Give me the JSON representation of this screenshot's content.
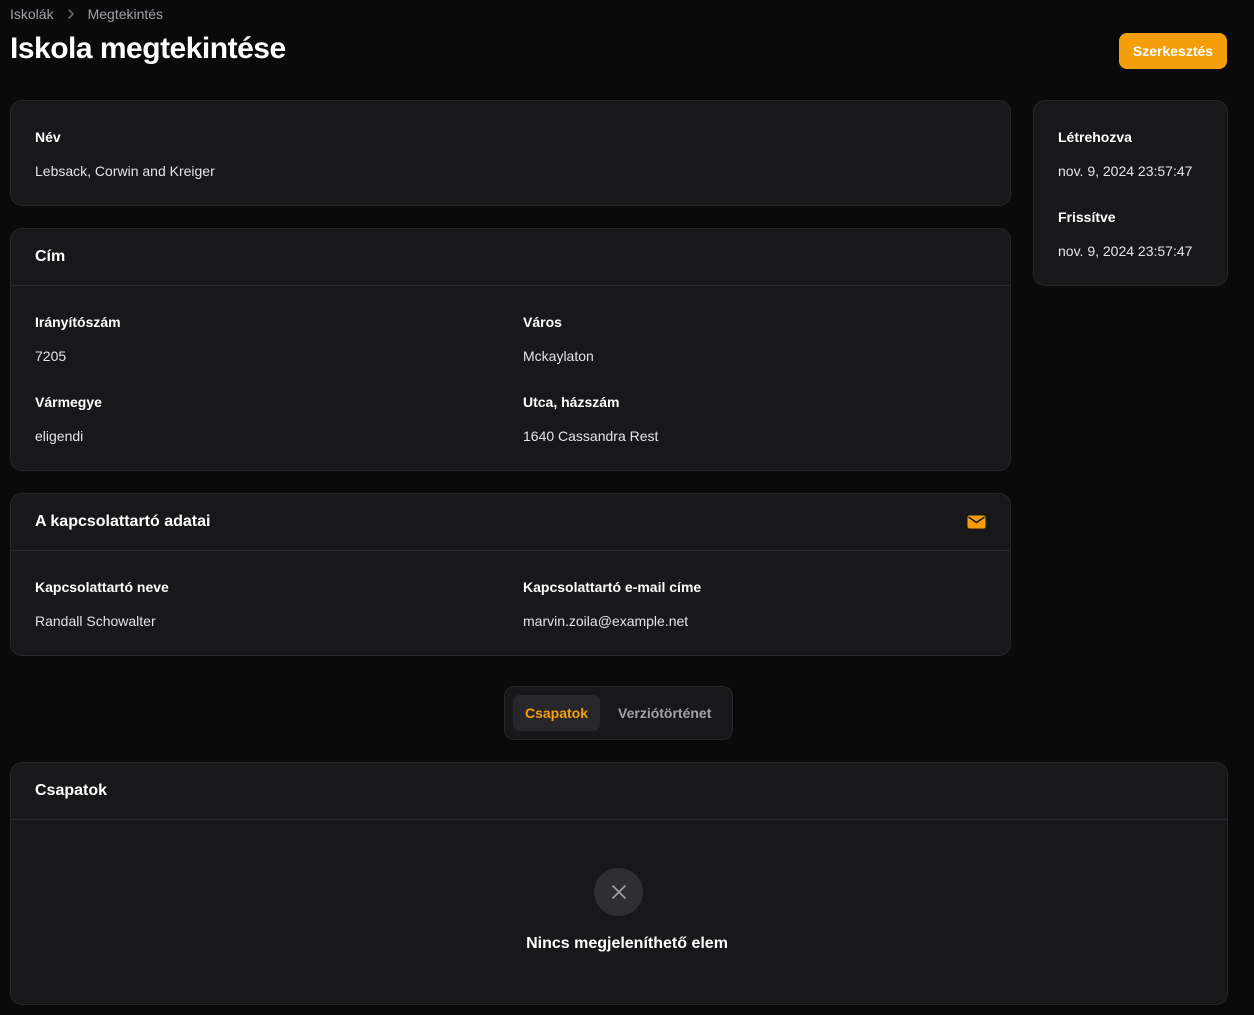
{
  "breadcrumb": {
    "items": [
      "Iskolák",
      "Megtekintés"
    ]
  },
  "header": {
    "title": "Iskola megtekintése",
    "edit_label": "Szerkesztés"
  },
  "name_card": {
    "label": "Név",
    "value": "Lebsack, Corwin and Kreiger"
  },
  "meta_card": {
    "created_label": "Létrehozva",
    "created_value": "nov. 9, 2024 23:57:47",
    "updated_label": "Frissítve",
    "updated_value": "nov. 9, 2024 23:57:47"
  },
  "address_card": {
    "title": "Cím",
    "zip_label": "Irányítószám",
    "zip_value": "7205",
    "city_label": "Város",
    "city_value": "Mckaylaton",
    "county_label": "Vármegye",
    "county_value": "eligendi",
    "street_label": "Utca, házszám",
    "street_value": "1640 Cassandra Rest"
  },
  "contact_card": {
    "title": "A kapcsolattartó adatai",
    "icon": "envelope-icon",
    "name_label": "Kapcsolattartó neve",
    "name_value": "Randall Schowalter",
    "email_label": "Kapcsolattartó e-mail címe",
    "email_value": "marvin.zoila@example.net"
  },
  "tabs": [
    {
      "label": "Csapatok",
      "active": true
    },
    {
      "label": "Verziótörténet",
      "active": false
    }
  ],
  "teams_card": {
    "title": "Csapatok",
    "empty_icon": "x-icon",
    "empty_text": "Nincs megjeleníthető elem"
  },
  "colors": {
    "accent": "#f59e0b",
    "background": "#0a0a0b",
    "card": "#18181b"
  }
}
